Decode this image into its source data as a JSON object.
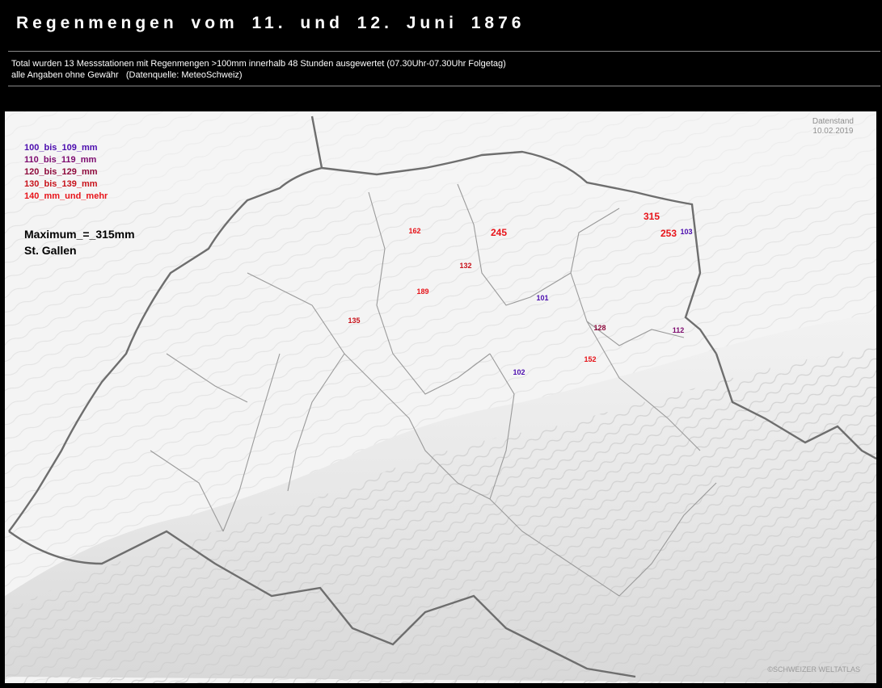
{
  "header": {
    "title": "Regenmengen vom 11. und 12. Juni 1876",
    "info_line1": "Total wurden 13 Messstationen mit Regenmengen >100mm innerhalb 48 Stunden ausgewertet (07.30Uhr-07.30Uhr Folgetag)",
    "info_line2": "alle Angaben ohne Gewähr   (Datenquelle: MeteoSchweiz)"
  },
  "map": {
    "legend": [
      {
        "label": "100_bis_109_mm",
        "color": "#4b0cae"
      },
      {
        "label": "110_bis_119_mm",
        "color": "#7d0a6e"
      },
      {
        "label": "120_bis_129_mm",
        "color": "#8e0a3c"
      },
      {
        "label": "130_bis_139_mm",
        "color": "#c8121a"
      },
      {
        "label": "140_mm_und_mehr",
        "color": "#e8141a"
      }
    ],
    "maximum_label": "Maximum_=_315mm",
    "maximum_station": "St. Gallen",
    "datenstand_label": "Datenstand",
    "datenstand_date": "10.02.2019",
    "copyright": "©SCHWEIZER WELTATLAS",
    "stations": [
      {
        "value": "162",
        "color": "#e8141a"
      },
      {
        "value": "245",
        "color": "#e8141a"
      },
      {
        "value": "132",
        "color": "#c8121a"
      },
      {
        "value": "189",
        "color": "#e8141a"
      },
      {
        "value": "135",
        "color": "#c8121a"
      },
      {
        "value": "101",
        "color": "#4b0cae"
      },
      {
        "value": "315",
        "color": "#e8141a"
      },
      {
        "value": "253",
        "color": "#e8141a"
      },
      {
        "value": "103",
        "color": "#4b0cae"
      },
      {
        "value": "128",
        "color": "#8e0a3c"
      },
      {
        "value": "152",
        "color": "#e8141a"
      },
      {
        "value": "102",
        "color": "#4b0cae"
      },
      {
        "value": "112",
        "color": "#7d0a6e"
      }
    ]
  }
}
